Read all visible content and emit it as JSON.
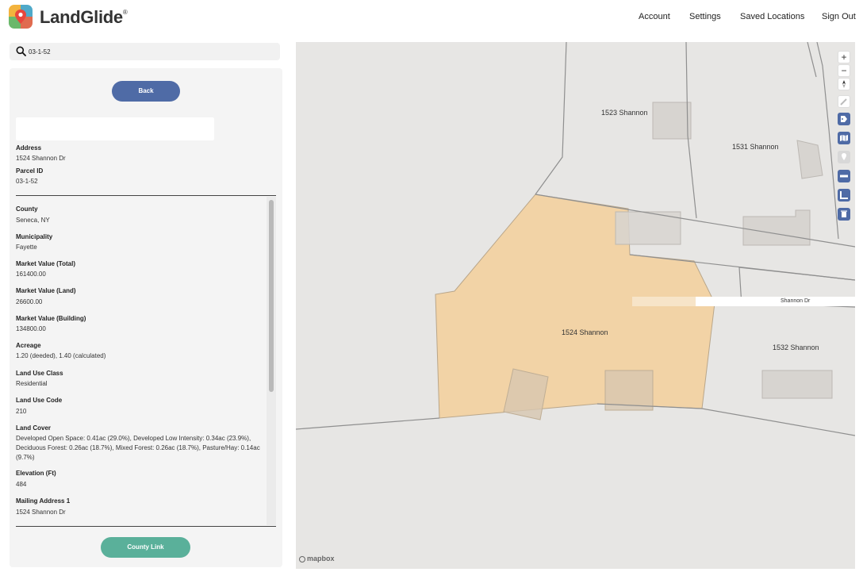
{
  "header": {
    "brand": "LandGlide",
    "brand_mark": "®",
    "nav": [
      "Account",
      "Settings",
      "Saved Locations",
      "Sign Out"
    ]
  },
  "search": {
    "value": "03-1-52"
  },
  "panel": {
    "back_label": "Back",
    "county_link_label": "County Link",
    "summary": [
      {
        "label": "Address",
        "value": "1524 Shannon Dr"
      },
      {
        "label": "Parcel ID",
        "value": "03-1-52"
      }
    ],
    "fields": [
      {
        "label": "County",
        "value": "Seneca, NY"
      },
      {
        "label": "Municipality",
        "value": "Fayette"
      },
      {
        "label": "Market Value (Total)",
        "value": "161400.00"
      },
      {
        "label": "Market Value (Land)",
        "value": "26600.00"
      },
      {
        "label": "Market Value (Building)",
        "value": "134800.00"
      },
      {
        "label": "Acreage",
        "value": "1.20 (deeded), 1.40 (calculated)"
      },
      {
        "label": "Land Use Class",
        "value": "Residential"
      },
      {
        "label": "Land Use Code",
        "value": "210"
      }
    ],
    "land_cover": {
      "label": "Land Cover",
      "value": "Developed Open Space: 0.41ac (29.0%), Developed Low Intensity: 0.34ac (23.9%), Deciduous Forest: 0.26ac (18.7%), Mixed Forest: 0.26ac (18.7%), Pasture/Hay: 0.14ac (9.7%)"
    },
    "more_fields": [
      {
        "label": "Elevation (Ft)",
        "value": "484"
      },
      {
        "label": "Mailing Address 1",
        "value": "1524 Shannon Dr"
      }
    ]
  },
  "map": {
    "labels": [
      "1523 Shannon",
      "1531 Shannon",
      "1524 Shannon",
      "1532 Shannon"
    ],
    "road_label": "Shannon Dr",
    "attribution": "mapbox",
    "controls": {
      "zoom_in": "+",
      "zoom_out": "−",
      "icons": [
        "compass-icon",
        "pencil-icon",
        "tag-icon",
        "map-icon",
        "pin-icon",
        "ruler-icon",
        "angle-icon",
        "trash-icon"
      ]
    },
    "colors": {
      "selected_parcel": "#f2d3a6",
      "accent": "#4f6ba6"
    }
  }
}
